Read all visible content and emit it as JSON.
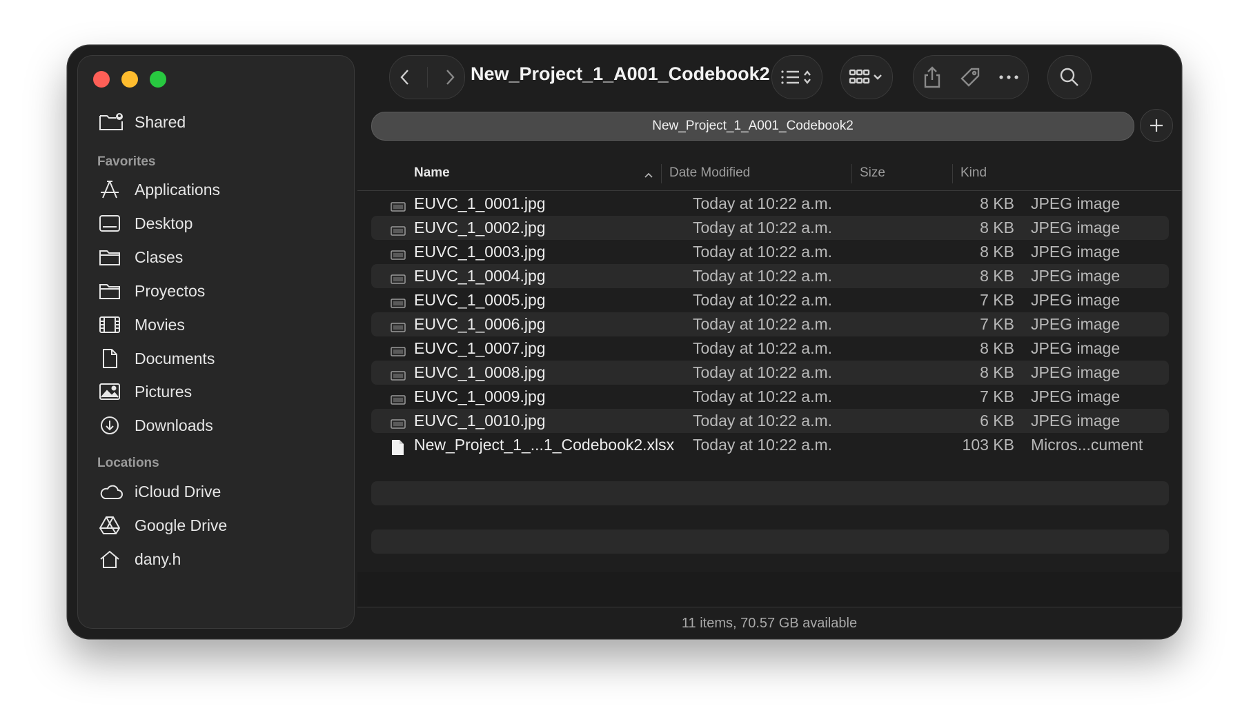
{
  "window": {
    "title": "New_Project_1_A001_Codebook2"
  },
  "tab": {
    "label": "New_Project_1_A001_Codebook2"
  },
  "sidebar": {
    "shared_label": "Shared",
    "favorites_heading": "Favorites",
    "favorites": [
      {
        "label": "Applications",
        "icon": "applications-icon"
      },
      {
        "label": "Desktop",
        "icon": "desktop-icon"
      },
      {
        "label": "Clases",
        "icon": "folder-icon"
      },
      {
        "label": "Proyectos",
        "icon": "folder-icon"
      },
      {
        "label": "Movies",
        "icon": "film-icon"
      },
      {
        "label": "Documents",
        "icon": "document-icon"
      },
      {
        "label": "Pictures",
        "icon": "photo-icon"
      },
      {
        "label": "Downloads",
        "icon": "download-icon"
      }
    ],
    "locations_heading": "Locations",
    "locations": [
      {
        "label": "iCloud Drive",
        "icon": "cloud-icon"
      },
      {
        "label": "Google Drive",
        "icon": "google-drive-icon"
      },
      {
        "label": "dany.h",
        "icon": "home-icon"
      }
    ]
  },
  "columns": {
    "name": "Name",
    "date": "Date Modified",
    "size": "Size",
    "kind": "Kind"
  },
  "files": [
    {
      "name": "EUVC_1_0001.jpg",
      "date": "Today at 10:22 a.m.",
      "size": "8 KB",
      "kind": "JPEG image"
    },
    {
      "name": "EUVC_1_0002.jpg",
      "date": "Today at 10:22 a.m.",
      "size": "8 KB",
      "kind": "JPEG image"
    },
    {
      "name": "EUVC_1_0003.jpg",
      "date": "Today at 10:22 a.m.",
      "size": "8 KB",
      "kind": "JPEG image"
    },
    {
      "name": "EUVC_1_0004.jpg",
      "date": "Today at 10:22 a.m.",
      "size": "8 KB",
      "kind": "JPEG image"
    },
    {
      "name": "EUVC_1_0005.jpg",
      "date": "Today at 10:22 a.m.",
      "size": "7 KB",
      "kind": "JPEG image"
    },
    {
      "name": "EUVC_1_0006.jpg",
      "date": "Today at 10:22 a.m.",
      "size": "7 KB",
      "kind": "JPEG image"
    },
    {
      "name": "EUVC_1_0007.jpg",
      "date": "Today at 10:22 a.m.",
      "size": "8 KB",
      "kind": "JPEG image"
    },
    {
      "name": "EUVC_1_0008.jpg",
      "date": "Today at 10:22 a.m.",
      "size": "8 KB",
      "kind": "JPEG image"
    },
    {
      "name": "EUVC_1_0009.jpg",
      "date": "Today at 10:22 a.m.",
      "size": "7 KB",
      "kind": "JPEG image"
    },
    {
      "name": "EUVC_1_0010.jpg",
      "date": "Today at 10:22 a.m.",
      "size": "6 KB",
      "kind": "JPEG image"
    },
    {
      "name": "New_Project_1_...1_Codebook2.xlsx",
      "date": "Today at 10:22 a.m.",
      "size": "103 KB",
      "kind": "Micros...cument"
    }
  ],
  "status": {
    "text": "11 items, 70.57 GB available"
  }
}
